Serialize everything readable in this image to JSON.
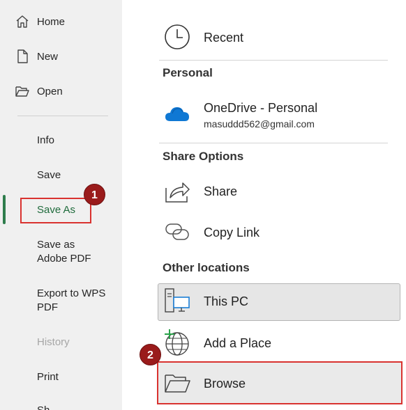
{
  "sidebar": {
    "items": [
      {
        "label": "Home",
        "icon": "home-icon"
      },
      {
        "label": "New",
        "icon": "new-document-icon"
      },
      {
        "label": "Open",
        "icon": "folder-open-icon"
      },
      {
        "label": "Info"
      },
      {
        "label": "Save"
      },
      {
        "label": "Save As",
        "active": true
      },
      {
        "label": "Save as\nAdobe PDF"
      },
      {
        "label": "Export to WPS\nPDF"
      },
      {
        "label": "History",
        "disabled": true
      },
      {
        "label": "Print"
      },
      {
        "label": "Sh"
      }
    ]
  },
  "annotations": {
    "badge1": "1",
    "badge2": "2",
    "highlight_color": "#d9322f",
    "badge_color": "#9a1b1b"
  },
  "main": {
    "recent": {
      "label": "Recent",
      "icon": "clock-icon"
    },
    "personal": {
      "heading": "Personal",
      "onedrive": {
        "label": "OneDrive - Personal",
        "email": "masuddd562@gmail.com",
        "icon": "onedrive-cloud-icon"
      }
    },
    "share_options": {
      "heading": "Share Options",
      "share": {
        "label": "Share",
        "icon": "share-arrow-icon"
      },
      "copy_link": {
        "label": "Copy Link",
        "icon": "link-icon"
      }
    },
    "other_locations": {
      "heading": "Other locations",
      "this_pc": {
        "label": "This PC",
        "icon": "computer-icon"
      },
      "add_place": {
        "label": "Add a Place",
        "icon": "globe-add-icon"
      },
      "browse": {
        "label": "Browse",
        "icon": "folder-icon"
      }
    }
  },
  "colors": {
    "accent_green": "#1f6b3c",
    "onedrive_blue": "#0f78d4"
  }
}
